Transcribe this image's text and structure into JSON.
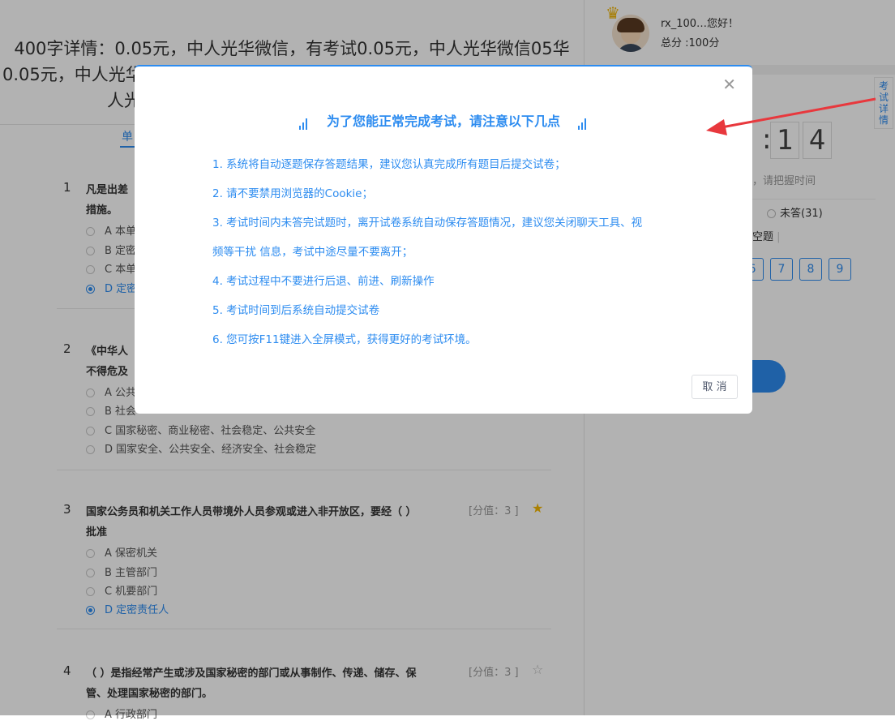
{
  "exam": {
    "title_line1": "400字详情：0.05元，中人光华微信，有考试0.05元，中人光华微信05华",
    "title_line2": "0.05元，中人光华",
    "title_line3": "人光",
    "tab_label": "单"
  },
  "questions": [
    {
      "num": "1",
      "text_line1": "凡是出差",
      "text_line2": "措施。",
      "options": [
        {
          "label": "A 本单",
          "selected": false
        },
        {
          "label": "B 定密",
          "selected": false
        },
        {
          "label": "C 本单",
          "selected": false
        },
        {
          "label": "D 定密",
          "selected": true
        }
      ]
    },
    {
      "num": "2",
      "text_line1": "《中华人",
      "text_line2": "不得危及",
      "options": [
        {
          "label": "A 公共",
          "selected": false
        },
        {
          "label": "B 社会",
          "selected": false
        },
        {
          "label": "C 国家秘密、商业秘密、社会稳定、公共安全",
          "selected": false
        },
        {
          "label": "D 国家安全、公共安全、经济安全、社会稳定",
          "selected": false
        }
      ]
    },
    {
      "num": "3",
      "text_line1": "国家公务员和机关工作人员带境外人员参观或进入非开放区，要经（    ）",
      "text_line2": "批准",
      "score": "[分值：3 ]",
      "starred": true,
      "options": [
        {
          "label": "A 保密机关",
          "selected": false
        },
        {
          "label": "B 主管部门",
          "selected": false
        },
        {
          "label": "C 机要部门",
          "selected": false
        },
        {
          "label": "D 定密责任人",
          "selected": true
        }
      ]
    },
    {
      "num": "4",
      "text_line1": "（    ）是指经常产生或涉及国家秘密的部门或从事制作、传递、储存、保",
      "text_line2": "管、处理国家秘密的部门。",
      "score": "[分值：3 ]",
      "starred": false,
      "options": [
        {
          "label": "A 行政部门",
          "selected": false
        }
      ]
    }
  ],
  "user": {
    "name": "rx_100…",
    "greeting": "您好！",
    "score": "总分 :100分"
  },
  "side_tab": "考试详情",
  "timer": {
    "digit1": "1",
    "digit2": "4",
    "tip": "，请把握时间"
  },
  "stats": {
    "unanswered": "未答(31)",
    "empty_label": "空题"
  },
  "question_nav": [
    "6",
    "7",
    "8",
    "9"
  ],
  "modal": {
    "title": "为了您能正常完成考试，请注意以下几点",
    "items": [
      "1. 系统将自动逐题保存答题结果，建议您认真完成所有题目后提交试卷；",
      "2. 请不要禁用浏览器的Cookie；",
      "3. 考试时间内未答完试题时，离开试卷系统自动保存答题情况，建议您关闭聊天工具、视",
      "频等干扰 信息，考试中途尽量不要离开；",
      "4. 考试过程中不要进行后退、前进、刷新操作",
      "5. 考试时间到后系统自动提交试卷",
      "6. 您可按F11键进入全屏模式，获得更好的考试环境。"
    ],
    "cancel_label": "取 消"
  },
  "colors": {
    "accent": "#2d8cf0",
    "annotation_arrow": "#e8383d"
  }
}
